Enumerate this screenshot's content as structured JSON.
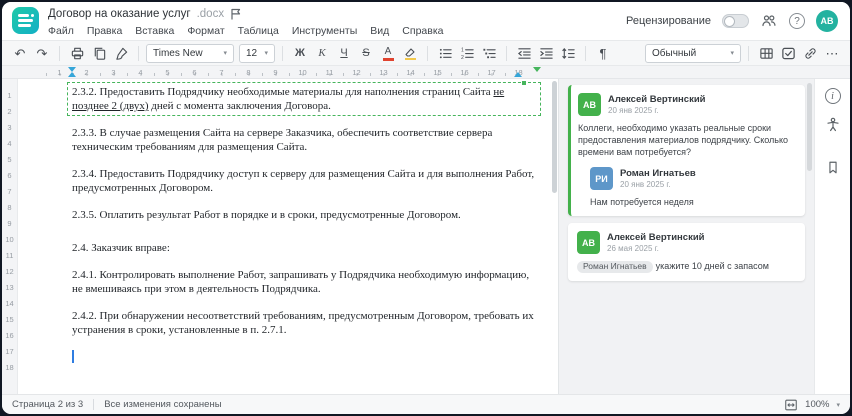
{
  "header": {
    "title": "Договор на оказание услуг",
    "title_ext": ".docx",
    "menu": [
      "Файл",
      "Правка",
      "Вставка",
      "Формат",
      "Таблица",
      "Инструменты",
      "Вид",
      "Справка"
    ],
    "review_label": "Рецензирование",
    "avatar_initials": "АВ"
  },
  "toolbar": {
    "font_name": "Times New",
    "font_size": "12",
    "bold": "Ж",
    "italic": "К",
    "underline": "Ч",
    "strike": "S",
    "color_letter": "А",
    "style_name": "Обычный"
  },
  "glyphs": {
    "undo": "↶",
    "redo": "↷",
    "caret": "▾",
    "kebab": "⋯",
    "pilcrow": "¶",
    "help": "?",
    "info": "i"
  },
  "ruler": {
    "h_numbers": [
      1,
      2,
      3,
      4,
      5,
      6,
      7,
      8,
      9,
      10,
      11,
      12,
      13,
      14,
      15,
      16,
      17,
      18
    ],
    "v_numbers": [
      1,
      2,
      3,
      4,
      5,
      6,
      7,
      8,
      9,
      10,
      11,
      12,
      13,
      14,
      15,
      16,
      17,
      18
    ]
  },
  "document": {
    "p1_pre": "2.3.2. Предоставить Подрядчику необходимые материалы для наполнения страниц Сайта ",
    "p1_ins": "не позднее 2 (двух)",
    "p1_post": " дней с момента заключения Договора.",
    "p2": "2.3.3. В случае размещения Сайта на сервере Заказчика, обеспечить соответствие сервера техническим требованиям для размещения Сайта.",
    "p3": "2.3.4. Предоставить Подрядчику доступ к серверу для размещения Сайта и для выполнения Работ, предусмотренных Договором.",
    "p4": "2.3.5. Оплатить результат Работ в порядке и в сроки, предусмотренные Договором.",
    "p5": "2.4. Заказчик вправе:",
    "p6": "2.4.1. Контролировать выполнение Работ, запрашивать у Подрядчика необходимую информацию, не вмешиваясь при этом в деятельность Подрядчика.",
    "p7": "2.4.2. При обнаружении несоответствий требованиям, предусмотренным Договором, требовать их устранения в сроки, установленные в п. 2.7.1."
  },
  "comments": {
    "thread1": {
      "author": "Алексей Вертинский",
      "initials": "АВ",
      "date": "20 янв 2025 г.",
      "text": "Коллеги, необходимо указать реальные сроки предоставления материалов подрядчику. Сколько времени вам потребуется?",
      "reply": {
        "author": "Роман Игнатьев",
        "initials": "РИ",
        "date": "20 янв 2025 г.",
        "text": "Нам потребуется неделя"
      }
    },
    "thread2": {
      "author": "Алексей Вертинский",
      "initials": "АВ",
      "date": "26 мая 2025 г.",
      "mention": "Роман Игнатьев",
      "text": "укажите 10 дней с запасом"
    }
  },
  "statusbar": {
    "page_info": "Страница 2 из 3",
    "save_status": "Все изменения сохранены",
    "zoom": "100%"
  },
  "colors": {
    "accent_teal": "#1fc9a8",
    "comment_green": "#43b14b",
    "reply_blue": "#5e97c9",
    "anchor_green": "#46b55c",
    "font_color_bar": "#e0432f",
    "highlight_bar": "#f2c84b"
  }
}
